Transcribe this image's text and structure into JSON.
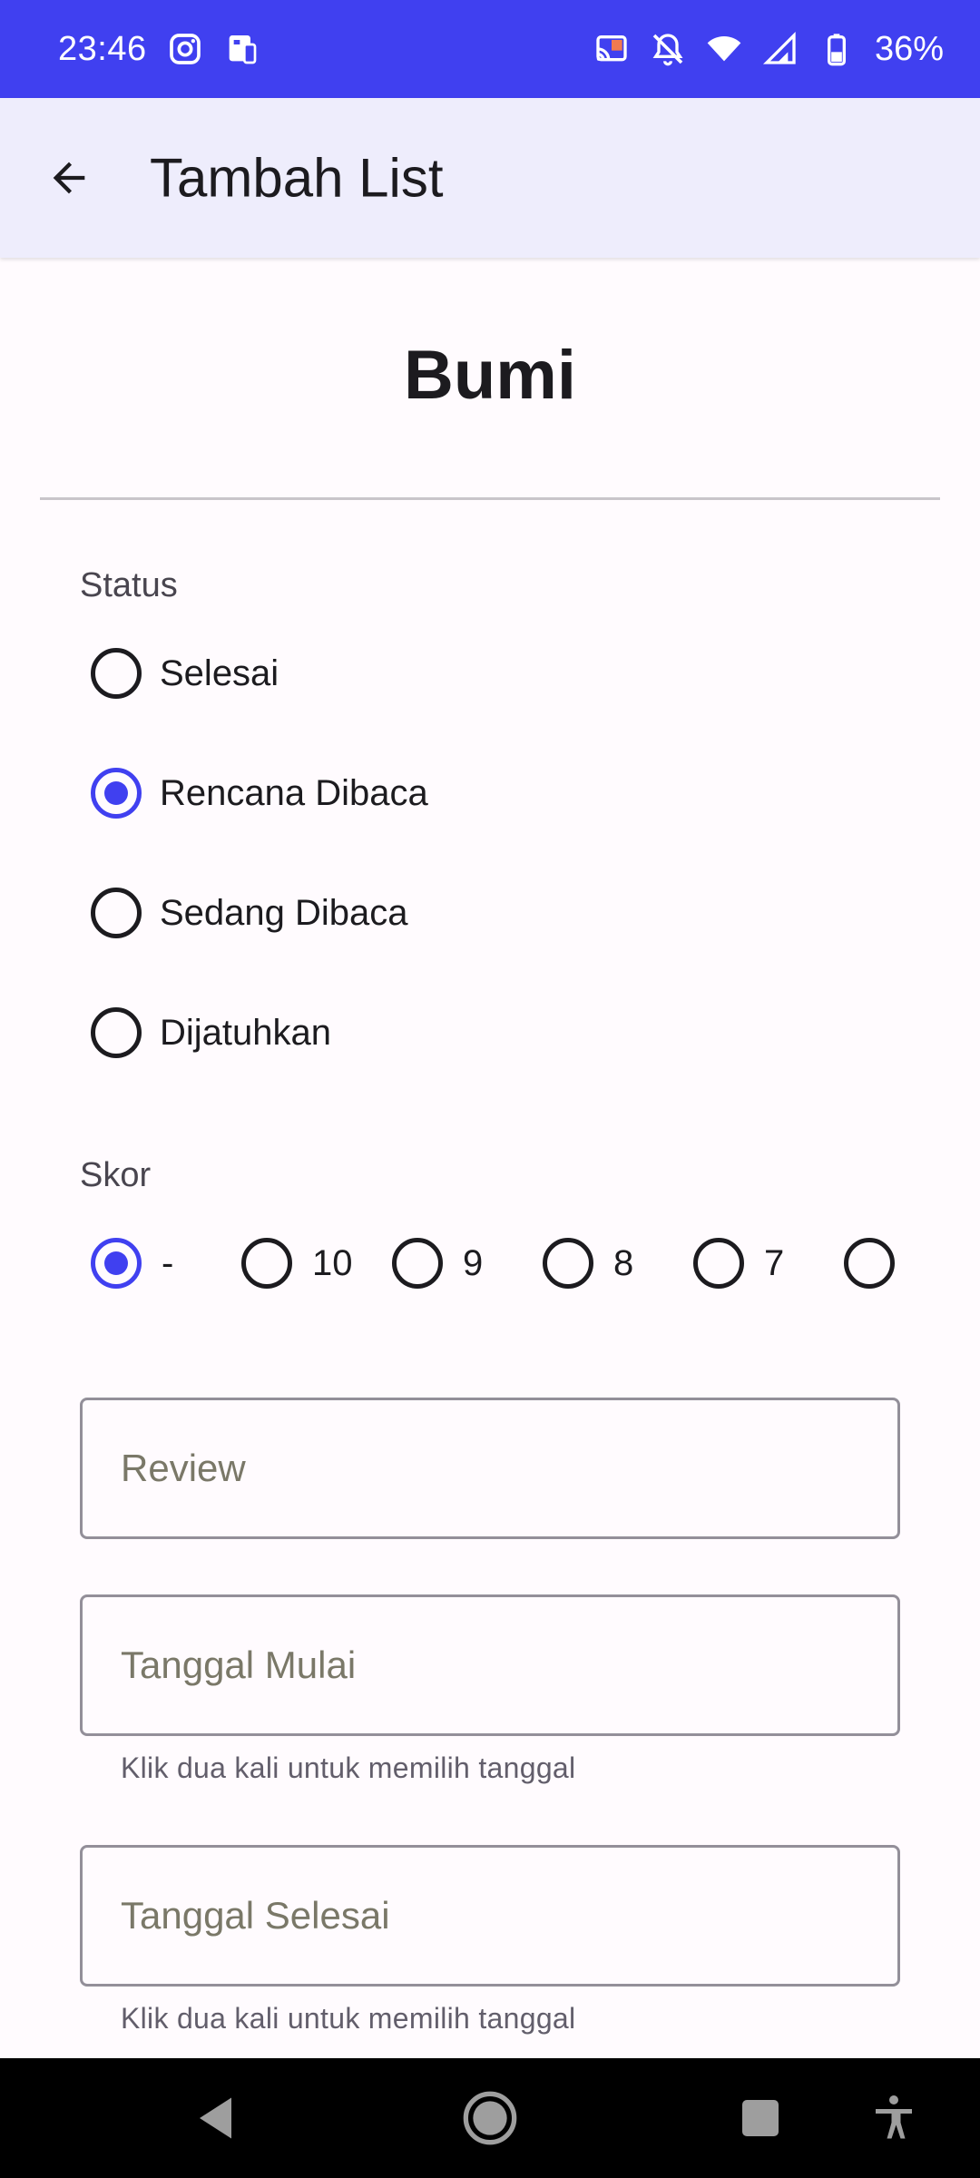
{
  "status_bar": {
    "time": "23:46",
    "battery_percent": "36%",
    "icons": [
      "instagram-icon",
      "device-icon",
      "cast-icon",
      "notifications-off-icon",
      "wifi-icon",
      "signal-icon",
      "battery-icon"
    ]
  },
  "app_bar": {
    "title": "Tambah List"
  },
  "book": {
    "title": "Bumi"
  },
  "status_section": {
    "label": "Status",
    "options": [
      {
        "label": "Selesai",
        "checked": false
      },
      {
        "label": "Rencana Dibaca",
        "checked": true
      },
      {
        "label": "Sedang Dibaca",
        "checked": false
      },
      {
        "label": "Dijatuhkan",
        "checked": false
      }
    ]
  },
  "score_section": {
    "label": "Skor",
    "options": [
      {
        "label": "-",
        "checked": true
      },
      {
        "label": "10",
        "checked": false
      },
      {
        "label": "9",
        "checked": false
      },
      {
        "label": "8",
        "checked": false
      },
      {
        "label": "7",
        "checked": false
      },
      {
        "label": "",
        "checked": false
      }
    ]
  },
  "fields": {
    "review_placeholder": "Review",
    "start_date_placeholder": "Tanggal Mulai",
    "start_date_helper": "Klik dua kali untuk memilih tanggal",
    "end_date_placeholder": "Tanggal Selesai",
    "end_date_helper": "Klik dua kali untuk memilih tanggal"
  },
  "colors": {
    "accent": "#4040f0",
    "app_bar_bg": "#eeedfc",
    "background": "#fffbfe"
  }
}
